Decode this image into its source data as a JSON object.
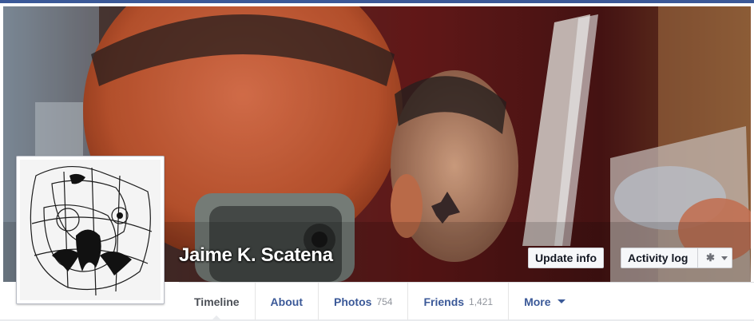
{
  "profile": {
    "name": "Jaime K. Scatena"
  },
  "actions": {
    "update_info_label": "Update info",
    "activity_log_label": "Activity log"
  },
  "icons": {
    "settings": "gear-icon",
    "dropdown": "caret-down-icon"
  },
  "tabs": [
    {
      "label": "Timeline",
      "count": "",
      "active": true
    },
    {
      "label": "About",
      "count": ""
    },
    {
      "label": "Photos",
      "count": "754"
    },
    {
      "label": "Friends",
      "count": "1,421"
    },
    {
      "label": "More",
      "count": ""
    }
  ],
  "colors": {
    "brand": "#3b5998",
    "tab_text": "#3b5998",
    "active_tab_text": "#4b4f56",
    "count_text": "#90949c"
  }
}
